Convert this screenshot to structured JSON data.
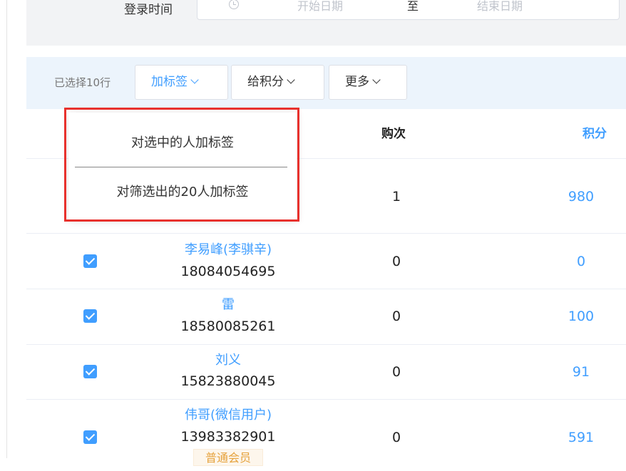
{
  "filter": {
    "login_time_label": "登录时间",
    "start_placeholder": "开始日期",
    "separator": "至",
    "end_placeholder": "结束日期"
  },
  "toolbar": {
    "selected_count": "已选择10行",
    "buttons": [
      {
        "label": "加标签",
        "active": true
      },
      {
        "label": "给积分",
        "active": false
      },
      {
        "label": "更多",
        "active": false
      }
    ]
  },
  "dropdown": {
    "items": [
      "对选中的人加标签",
      "对筛选出的20人加标签"
    ]
  },
  "table": {
    "headers": {
      "purchases": "购次",
      "points": "积分"
    },
    "rows": [
      {
        "name": "",
        "phone": "",
        "purchases": "1",
        "points": "980",
        "tag": "",
        "checked": true
      },
      {
        "name": "李易峰(李骐辛)",
        "phone": "18084054695",
        "purchases": "0",
        "points": "0",
        "tag": "",
        "checked": true
      },
      {
        "name": "雷",
        "phone": "18580085261",
        "purchases": "0",
        "points": "100",
        "tag": "",
        "checked": true
      },
      {
        "name": "刘义",
        "phone": "15823880045",
        "purchases": "0",
        "points": "91",
        "tag": "",
        "checked": true
      },
      {
        "name": "伟哥(微信用户)",
        "phone": "13983382901",
        "purchases": "0",
        "points": "591",
        "tag": "普通会员",
        "checked": true
      }
    ]
  },
  "colors": {
    "accent": "#409eff",
    "highlight": "#e8312d",
    "tag_text": "#e6a23c"
  }
}
